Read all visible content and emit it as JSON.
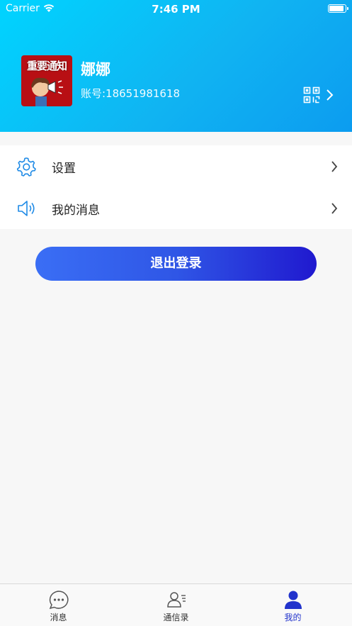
{
  "status_bar": {
    "carrier": "Carrier",
    "time": "7:46 PM",
    "battery_level": 0.95
  },
  "profile": {
    "avatar_text": "重要通知",
    "name": "娜娜",
    "account": "账号:18651981618"
  },
  "menu": {
    "items": [
      {
        "label": "设置",
        "icon": "gear-icon"
      },
      {
        "label": "我的消息",
        "icon": "speaker-icon"
      }
    ]
  },
  "logout": {
    "label": "退出登录"
  },
  "tabs": [
    {
      "label": "消息",
      "icon": "chat-bubble-icon",
      "active": false
    },
    {
      "label": "通信录",
      "icon": "contacts-icon",
      "active": false
    },
    {
      "label": "我的",
      "icon": "person-icon",
      "active": true
    }
  ],
  "colors": {
    "accent": "#2233cc",
    "header": "#10b4f2",
    "icon_blue": "#1e8ae6"
  }
}
